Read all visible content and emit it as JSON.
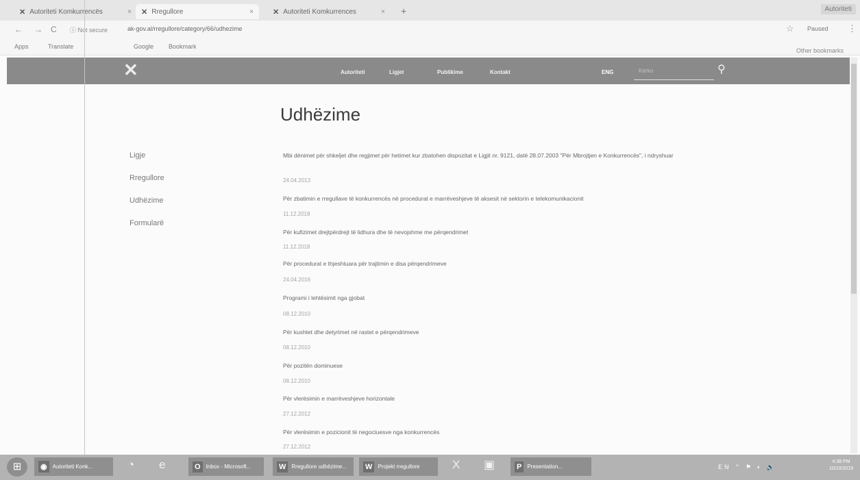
{
  "browser": {
    "tabs": [
      "Autoriteti Komkurrencës",
      "Rregullore",
      "Autoriteti Komkurrences"
    ],
    "new_tab": "+",
    "window_controls": "Autoriteti",
    "back": "←",
    "forward": "→",
    "reload": "C",
    "security": "ⓘ Not secure",
    "url": "ak-gov.al/rregullore/category/66/udhezime",
    "star": "☆",
    "profile": "Paused",
    "menu": "⋮",
    "bookmarks": [
      "Apps",
      "Translate",
      "Google",
      "Bookmark"
    ],
    "other_bookmarks": "Other bookmarks"
  },
  "site": {
    "logo": "✕",
    "nav": [
      "Autoriteti",
      "Ligjet",
      "Publikime",
      "Kontakt"
    ],
    "lang": "ENG",
    "search_placeholder": "Kërko",
    "search_icon": "search-icon"
  },
  "page": {
    "title": "Udhëzime",
    "sidebar": [
      "Ligje",
      "Rregullore",
      "Udhëzime",
      "Formularë"
    ],
    "items": [
      {
        "text": "Mbi dënimet për shkeljet dhe regjimet për hetimet kur zbatohen dispozitat e Ligjit nr. 9121, datë 28.07.2003 \"Për Mbrojtjen e Konkurrencës\", i ndryshuar",
        "date": "24.04.2013"
      },
      {
        "text": "Për zbatimin e rregullave të konkurrencës në procedurat e marrëveshjeve të aksesit në sektorin e telekomunikacionit",
        "date": "11.12.2018"
      },
      {
        "text": "Për kufizimet drejtpërdrejt të lidhura dhe të nevojshme me përqendrimet",
        "date": "11.12.2018"
      },
      {
        "text": "Për procedurat e thjeshtuara për trajtimin e disa përqendrimeve",
        "date": "24.04.2016"
      },
      {
        "text": "Programi i lehtësimit nga gjobat",
        "date": "08.12.2010"
      },
      {
        "text": "Për kushtet dhe detyrimet në rastet e përqendrimeve",
        "date": "08.12.2010"
      },
      {
        "text": "Për pozitën dominuese",
        "date": "08.12.2010"
      },
      {
        "text": "Për vlerësimin e marrëveshjeve horizontale",
        "date": "27.12.2012"
      },
      {
        "text": "Për vlerësimin e pozicionit të negociuesve nga konkurrencës",
        "date": "27.12.2012"
      }
    ]
  },
  "taskbar": {
    "start": "⊞",
    "buttons": [
      "Autoriteti Konk...",
      "Inbox - Microsoft...",
      "Rregullore udhëzime...",
      "Projekt rregullore",
      "Presentation..."
    ],
    "tray": "EN ⌃ ⚑ ◐ 🔊",
    "time": "4:38 PM",
    "date": "10/10/2019"
  }
}
